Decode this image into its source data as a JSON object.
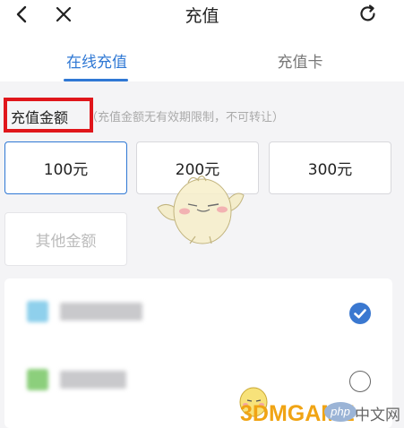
{
  "header": {
    "title": "充值",
    "back_icon": "chevron-left-icon",
    "close_icon": "close-icon",
    "refresh_icon": "refresh-icon"
  },
  "tabs": [
    {
      "label": "在线充值",
      "active": true
    },
    {
      "label": "充值卡",
      "active": false
    }
  ],
  "amount": {
    "label": "充值金额",
    "note": "（充值金额无有效期限制，不可转让）",
    "options": [
      {
        "label": "100元",
        "selected": true
      },
      {
        "label": "200元",
        "selected": false
      },
      {
        "label": "300元",
        "selected": false
      }
    ],
    "other_placeholder": "其他金额"
  },
  "payment_methods": [
    {
      "icon_color": "#8fd0ec",
      "selected": true
    },
    {
      "icon_color": "#8ccf7c",
      "selected": false
    }
  ],
  "watermark": {
    "logo_text": "3DMGAME",
    "php_badge": "php",
    "cn_text": "中文网"
  },
  "colors": {
    "accent": "#2f78d4",
    "highlight": "#e0161b",
    "watermark_gold": "#f0a414"
  }
}
